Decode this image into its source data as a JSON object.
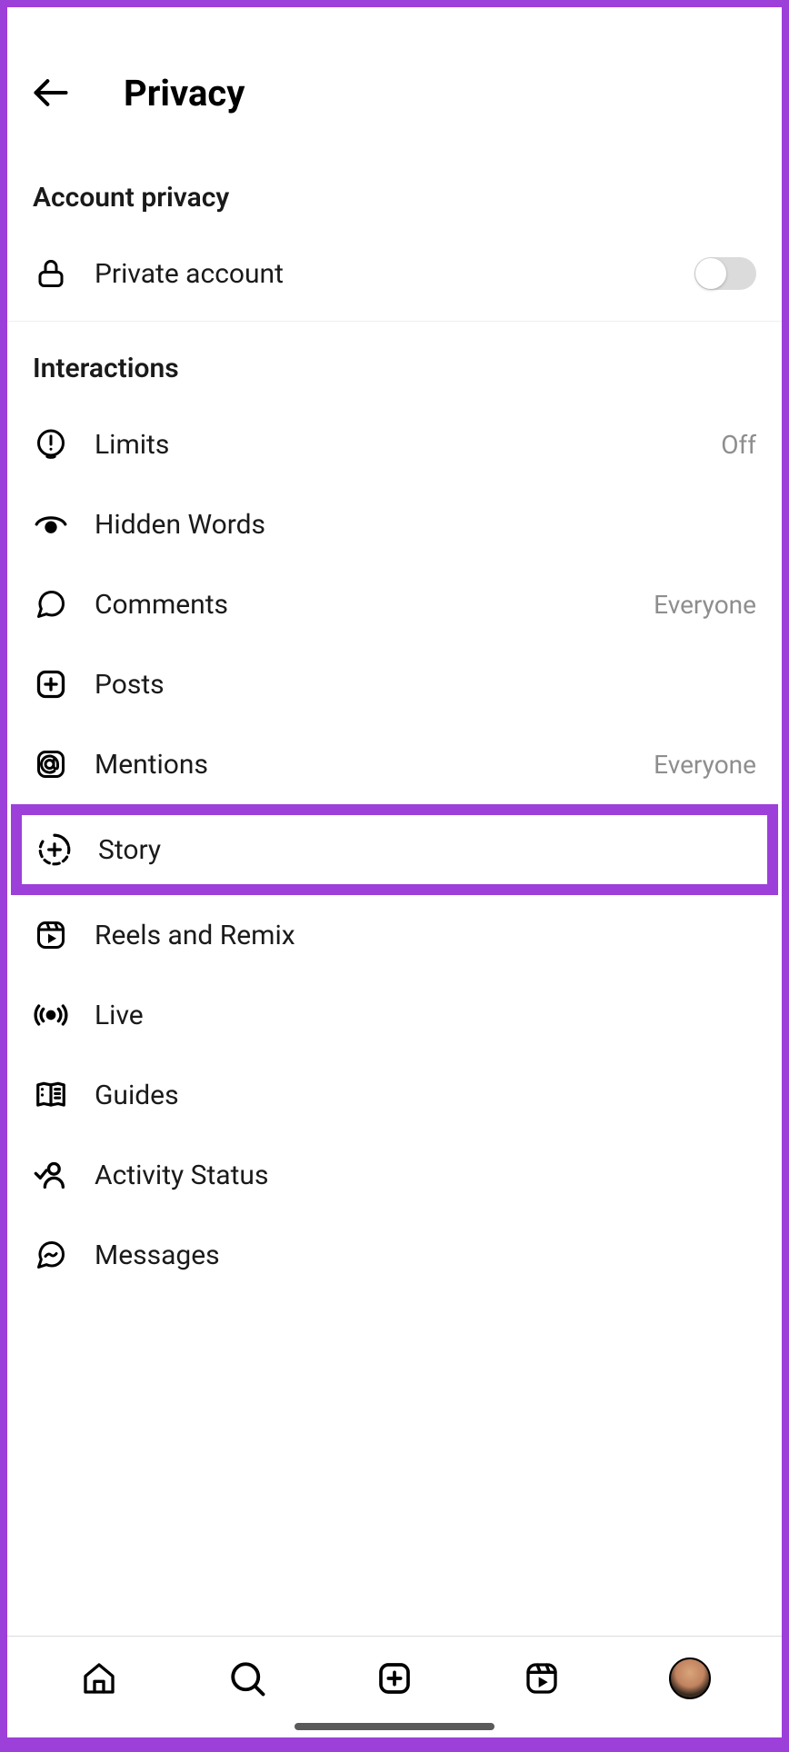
{
  "header": {
    "title": "Privacy"
  },
  "account_privacy": {
    "section_label": "Account privacy",
    "private_account_label": "Private account",
    "private_account_on": false
  },
  "interactions": {
    "section_label": "Interactions",
    "items": [
      {
        "id": "limits",
        "label": "Limits",
        "value": "Off",
        "icon": "limits-icon"
      },
      {
        "id": "hidden-words",
        "label": "Hidden Words",
        "value": "",
        "icon": "hidden-words-icon"
      },
      {
        "id": "comments",
        "label": "Comments",
        "value": "Everyone",
        "icon": "comment-icon"
      },
      {
        "id": "posts",
        "label": "Posts",
        "value": "",
        "icon": "posts-icon"
      },
      {
        "id": "mentions",
        "label": "Mentions",
        "value": "Everyone",
        "icon": "mentions-icon"
      },
      {
        "id": "story",
        "label": "Story",
        "value": "",
        "icon": "story-icon",
        "highlighted": true
      },
      {
        "id": "reels",
        "label": "Reels and Remix",
        "value": "",
        "icon": "reels-icon"
      },
      {
        "id": "live",
        "label": "Live",
        "value": "",
        "icon": "live-icon"
      },
      {
        "id": "guides",
        "label": "Guides",
        "value": "",
        "icon": "guides-icon"
      },
      {
        "id": "activity-status",
        "label": "Activity Status",
        "value": "",
        "icon": "activity-status-icon"
      },
      {
        "id": "messages",
        "label": "Messages",
        "value": "",
        "icon": "messages-icon"
      }
    ]
  },
  "colors": {
    "highlight": "#9d3fd9",
    "text_secondary": "#8e8e8e"
  }
}
